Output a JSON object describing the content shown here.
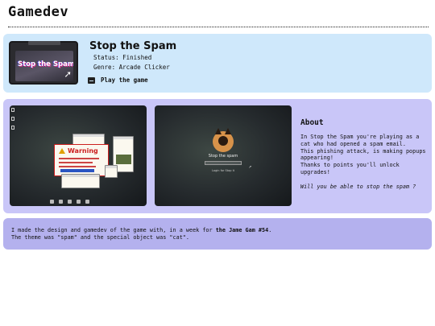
{
  "page": {
    "title": "Gamedev"
  },
  "game": {
    "cover_text": "Stop the Spam",
    "title": "Stop the Spam",
    "status": "Status: Finished",
    "genre": "Genre: Arcade Clicker",
    "play_label": "Play the game",
    "play_icon": "gamepad-icon"
  },
  "screenshots": [
    {
      "warning_title": "Warning"
    },
    {
      "login_title": "Stop the spam",
      "login_hint": "Login for Stop it"
    }
  ],
  "about": {
    "heading": "About",
    "lines": [
      "In Stop the Spam you're playing as a",
      "cat who had opened a spam email.",
      "This phishing attack, is making popups",
      "appearing!",
      "Thanks to points you'll unlock",
      "upgrades!"
    ],
    "question": "Will you be able to stop the spam ?"
  },
  "credits": {
    "line1_prefix": "I made the design and gamedev of the game with, in a week for ",
    "line1_jam": "the Jame Gam #54",
    "line1_suffix": ".",
    "line2": "The theme was \"spam\" and the special object was \"cat\"."
  },
  "colors": {
    "card_blue": "#cfe8fb",
    "card_lavender": "#c9c6f8",
    "card_purple": "#b4b1ee",
    "warning_red": "#cc1f1f"
  }
}
